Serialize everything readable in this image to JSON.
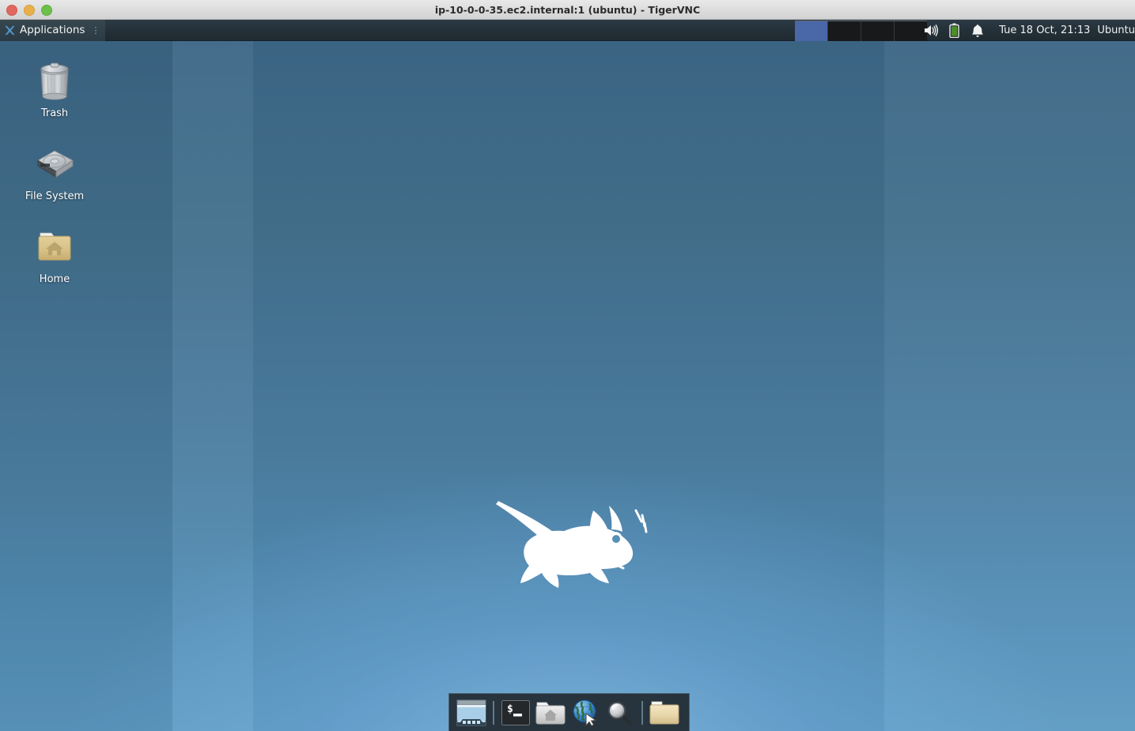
{
  "window": {
    "title": "ip-10-0-0-35.ec2.internal:1 (ubuntu) - TigerVNC",
    "controls": [
      {
        "name": "close",
        "color": "#e0685f"
      },
      {
        "name": "minimize",
        "color": "#e7b04a"
      },
      {
        "name": "maximize",
        "color": "#6dc04a"
      }
    ]
  },
  "panel": {
    "applications_label": "Applications",
    "applications_icon": "xfce-mouse-icon",
    "grip_glyph": "⋮",
    "workspaces": {
      "count": 4,
      "active_index": 0,
      "active_color": "#4a67a8",
      "inactive_color": "#18191b"
    },
    "tray": [
      {
        "name": "volume-icon",
        "label": "volume"
      },
      {
        "name": "battery-icon",
        "label": "battery"
      },
      {
        "name": "notification-bell-icon",
        "label": "notifications"
      }
    ],
    "clock": "Tue 18 Oct, 21:13",
    "session": "Ubuntu",
    "background_color": "#253139"
  },
  "desktop": {
    "wallpaper_colors": {
      "top": "#3d6786",
      "bottom": "#5e9bc4",
      "glow": "#84bee8"
    },
    "logo": {
      "name": "xfce-mouse-logo",
      "color": "#ffffff"
    },
    "icons": [
      {
        "name": "trash",
        "label": "Trash",
        "icon": "trash-can-icon"
      },
      {
        "name": "file-system",
        "label": "File System",
        "icon": "hard-disk-icon"
      },
      {
        "name": "home",
        "label": "Home",
        "icon": "home-folder-icon"
      }
    ]
  },
  "dock": {
    "background_color": "#27343d",
    "border_color": "#4d626f",
    "items": [
      {
        "name": "show-desktop",
        "icon": "show-desktop-icon",
        "label": "Show Desktop"
      },
      {
        "name": "separator-1",
        "icon": "separator",
        "label": ""
      },
      {
        "name": "terminal",
        "icon": "terminal-icon",
        "label": "Terminal"
      },
      {
        "name": "file-manager",
        "icon": "file-manager-icon",
        "label": "File Manager"
      },
      {
        "name": "web-browser",
        "icon": "web-browser-icon",
        "label": "Web Browser"
      },
      {
        "name": "find-files",
        "icon": "magnifier-icon",
        "label": "Find Files"
      },
      {
        "name": "separator-2",
        "icon": "separator",
        "label": ""
      },
      {
        "name": "open-folder",
        "icon": "open-folder-icon",
        "label": "Folder"
      }
    ]
  }
}
